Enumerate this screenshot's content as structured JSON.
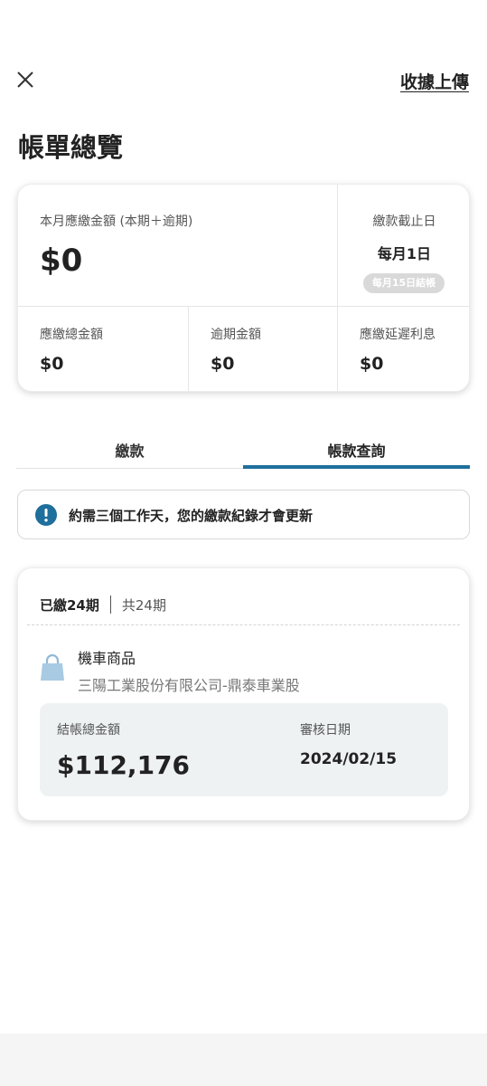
{
  "header": {
    "upload_label": "收據上傳",
    "title": "帳單總覽"
  },
  "summary": {
    "monthly_due_label": "本月應繳金額 (本期＋逾期)",
    "monthly_due_value": "$0",
    "due_date_label": "繳款截止日",
    "due_date_value": "每月1日",
    "billing_badge": "每月15日結帳",
    "total_due_label": "應繳總金額",
    "total_due_value": "$0",
    "overdue_label": "逾期金額",
    "overdue_value": "$0",
    "late_interest_label": "應繳延遲利息",
    "late_interest_value": "$0"
  },
  "tabs": [
    {
      "label": "繳款",
      "active": false
    },
    {
      "label": "帳款查詢",
      "active": true
    }
  ],
  "notice": {
    "text": "約需三個工作天，您的繳款紀錄才會更新"
  },
  "installment": {
    "paid": "已繳24期",
    "total": "共24期",
    "product_name": "機車商品",
    "company": "三陽工業股份有限公司-鼎泰車業股",
    "amount_label": "結帳總金額",
    "amount_value": "$112,176",
    "review_date_label": "審核日期",
    "review_date_value": "2024/02/15"
  },
  "colors": {
    "accent": "#1f6f9c",
    "badge_bg": "#d9d9d9",
    "amount_box_bg": "#eef2f3"
  },
  "icons": [
    "close-icon",
    "info-icon",
    "shopping-bag-icon"
  ]
}
